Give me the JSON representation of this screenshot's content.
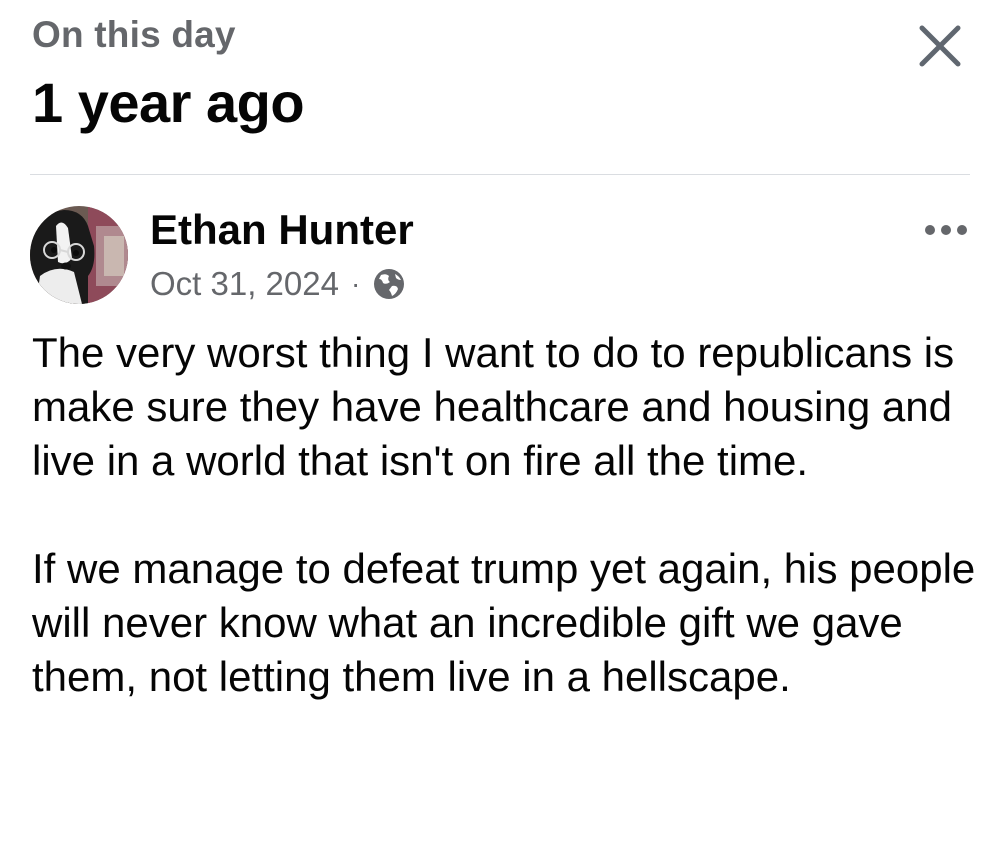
{
  "header": {
    "kicker": "On this day",
    "title": "1 year ago",
    "close_icon": "close-icon"
  },
  "post": {
    "author": "Ethan Hunter",
    "date": "Oct 31, 2024",
    "separator": "·",
    "audience_icon": "globe-icon",
    "more_icon": "more-horizontal-icon",
    "paragraphs": [
      "The very worst thing I want to do to republicans is make sure they have healthcare and housing and live in a world that isn't on fire all the time.",
      "If we manage to defeat trump yet again, his people will never know what an incredible gift we gave them, not letting them live in a hellscape."
    ]
  },
  "colors": {
    "primary_text": "#050505",
    "secondary_text": "#65676b",
    "divider": "#dadde1"
  }
}
